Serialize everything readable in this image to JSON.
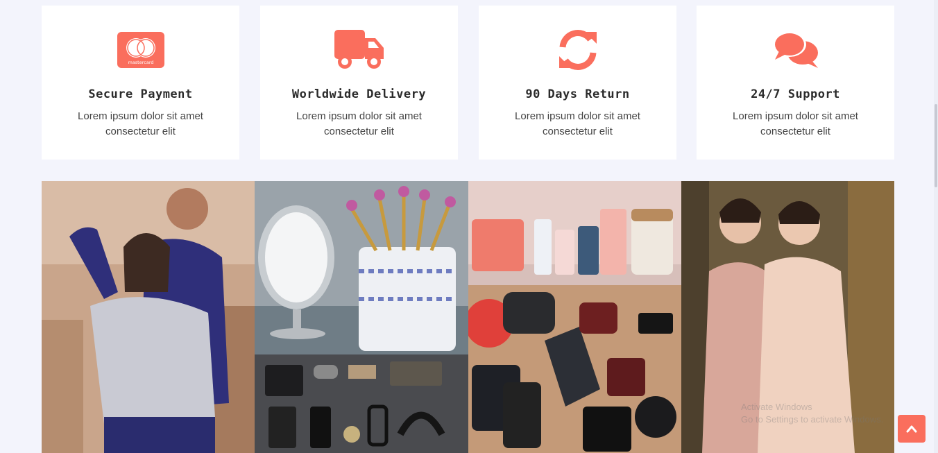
{
  "colors": {
    "accent": "#fa6e5d",
    "page_bg": "#f3f4fc",
    "card_bg": "#ffffff"
  },
  "features": [
    {
      "icon": "mastercard-icon",
      "title": "Secure Payment",
      "text": "Lorem ipsum dolor sit amet consectetur elit",
      "icon_text": "mastercard"
    },
    {
      "icon": "truck-icon",
      "title": "Worldwide Delivery",
      "text": "Lorem ipsum dolor sit amet consectetur elit"
    },
    {
      "icon": "refresh-icon",
      "title": "90 Days Return",
      "text": "Lorem ipsum dolor sit amet consectetur elit"
    },
    {
      "icon": "chat-icon",
      "title": "24/7 Support",
      "text": "Lorem ipsum dolor sit amet consectetur elit"
    }
  ],
  "gallery": [
    {
      "name": "couple-sweater-photo"
    },
    {
      "name": "makeup-brushes-photo"
    },
    {
      "name": "skincare-products-photo"
    },
    {
      "name": "mens-accessories-photo"
    },
    {
      "name": "gadgets-photo"
    },
    {
      "name": "women-dresses-photo"
    }
  ],
  "watermark": {
    "line1": "Activate Windows",
    "line2": "Go to Settings to activate Windows."
  },
  "back_to_top": {
    "icon": "chevron-up-icon"
  }
}
